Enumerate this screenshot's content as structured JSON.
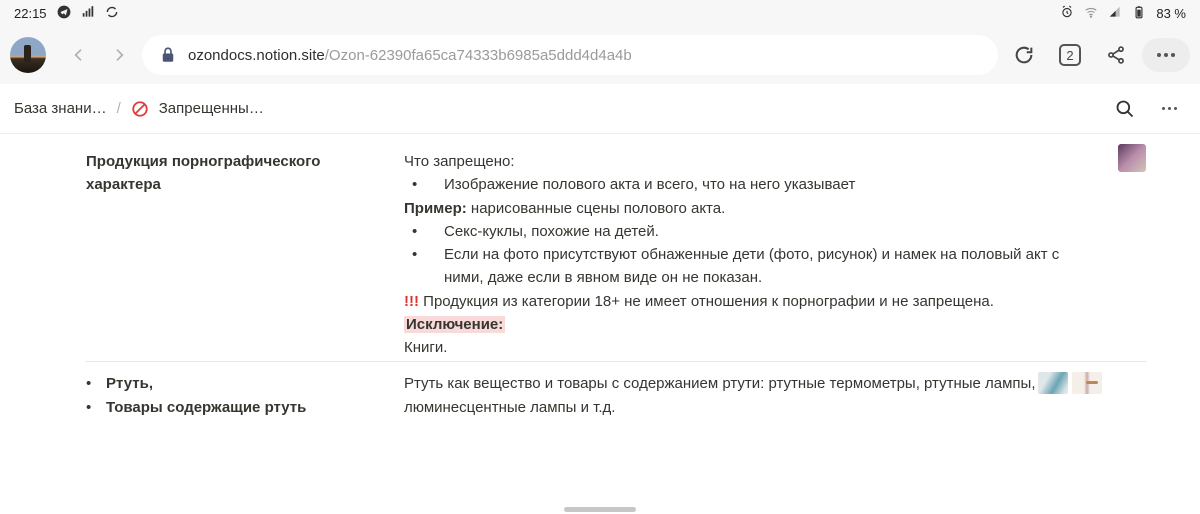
{
  "statusbar": {
    "time": "22:15",
    "battery": "83 %"
  },
  "browser": {
    "url_host": "ozondocs.notion.site",
    "url_path": "/Ozon-62390fa65ca74333b6985a5ddd4d4a4b",
    "tab_count": "2"
  },
  "breadcrumb": {
    "crumb1": "База знани…",
    "crumb2": "Запрещенны…"
  },
  "row1": {
    "title": "Продукция порнографического характера",
    "what_forbidden_label": "Что запрещено:",
    "bullet1": "Изображение полового акта и всего, что на него указывает",
    "example_label": "Пример:",
    "example_text": " нарисованные сцены полового акта.",
    "bullet2": "Секс-куклы, похожие на детей.",
    "bullet3": "Если на фото присутствуют обнаженные дети (фото, рисунок) и намек на половый акт с ними, даже если в явном виде он не показан.",
    "warn_prefix": "!!!",
    "warn_text": " Продукция из категории 18+ не имеет отношения к порнографии и не запрещена.",
    "exception_label": "Исключение:",
    "exception_text": "Книги."
  },
  "row2": {
    "bullet_a": "Ртуть,",
    "bullet_b": " Товары содержащие ртуть",
    "text": "Ртуть как вещество и товары с содержанием ртути: ртутные термометры, ртутные лампы, люминесцентные лампы и т.д."
  }
}
